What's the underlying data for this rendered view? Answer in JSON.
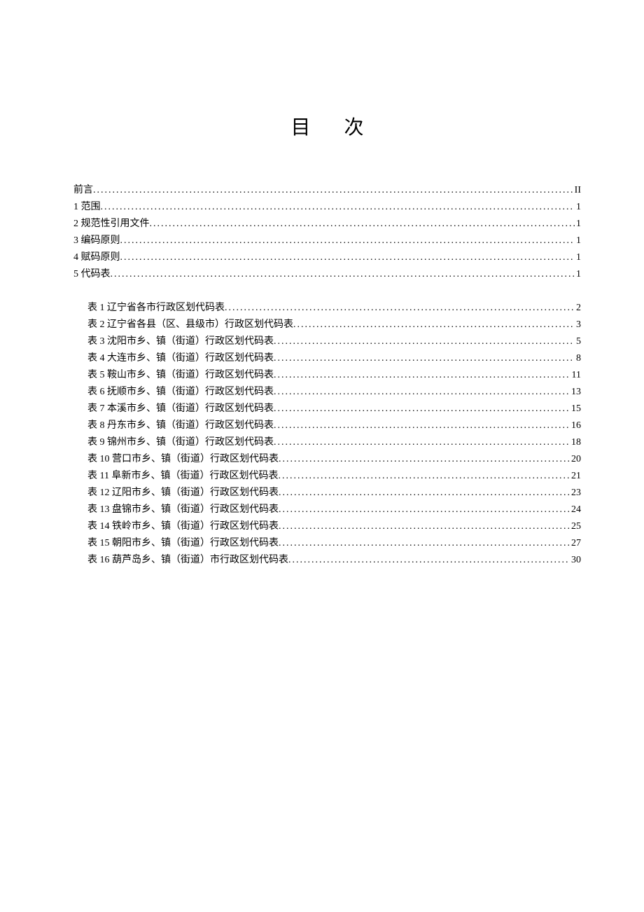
{
  "title": "目次",
  "main_entries": [
    {
      "label": "前言",
      "page": "II"
    },
    {
      "label": "1 范围",
      "page": "1"
    },
    {
      "label": "2 规范性引用文件",
      "page": "1"
    },
    {
      "label": "3 编码原则",
      "page": "1"
    },
    {
      "label": "4 赋码原则",
      "page": "1"
    },
    {
      "label": "5 代码表",
      "page": "1"
    }
  ],
  "table_entries": [
    {
      "label": "表 1 辽宁省各市行政区划代码表",
      "page": "2"
    },
    {
      "label": "表 2 辽宁省各县（区、县级市）行政区划代码表",
      "page": "3"
    },
    {
      "label": "表 3 沈阳市乡、镇（街道）行政区划代码表",
      "page": "5"
    },
    {
      "label": "表 4 大连市乡、镇（街道）行政区划代码表",
      "page": "8"
    },
    {
      "label": "表 5 鞍山市乡、镇（街道）行政区划代码表",
      "page": "11"
    },
    {
      "label": "表 6 抚顺市乡、镇（街道）行政区划代码表",
      "page": "13"
    },
    {
      "label": "表 7 本溪市乡、镇（街道）行政区划代码表",
      "page": "15"
    },
    {
      "label": "表 8 丹东市乡、镇（街道）行政区划代码表",
      "page": "16"
    },
    {
      "label": "表 9 锦州市乡、镇（街道）行政区划代码表",
      "page": "18"
    },
    {
      "label": "表 10 营口市乡、镇（街道）行政区划代码表",
      "page": "20"
    },
    {
      "label": "表 11 阜新市乡、镇（街道）行政区划代码表",
      "page": "21"
    },
    {
      "label": "表 12 辽阳市乡、镇（街道）行政区划代码表",
      "page": "23"
    },
    {
      "label": "表 13 盘锦市乡、镇（街道）行政区划代码表",
      "page": "24"
    },
    {
      "label": "表 14 铁岭市乡、镇（街道）行政区划代码表",
      "page": "25"
    },
    {
      "label": "表 15 朝阳市乡、镇（街道）行政区划代码表",
      "page": "27"
    },
    {
      "label": "表 16 葫芦岛乡、镇（街道）市行政区划代码表",
      "page": "30"
    }
  ]
}
